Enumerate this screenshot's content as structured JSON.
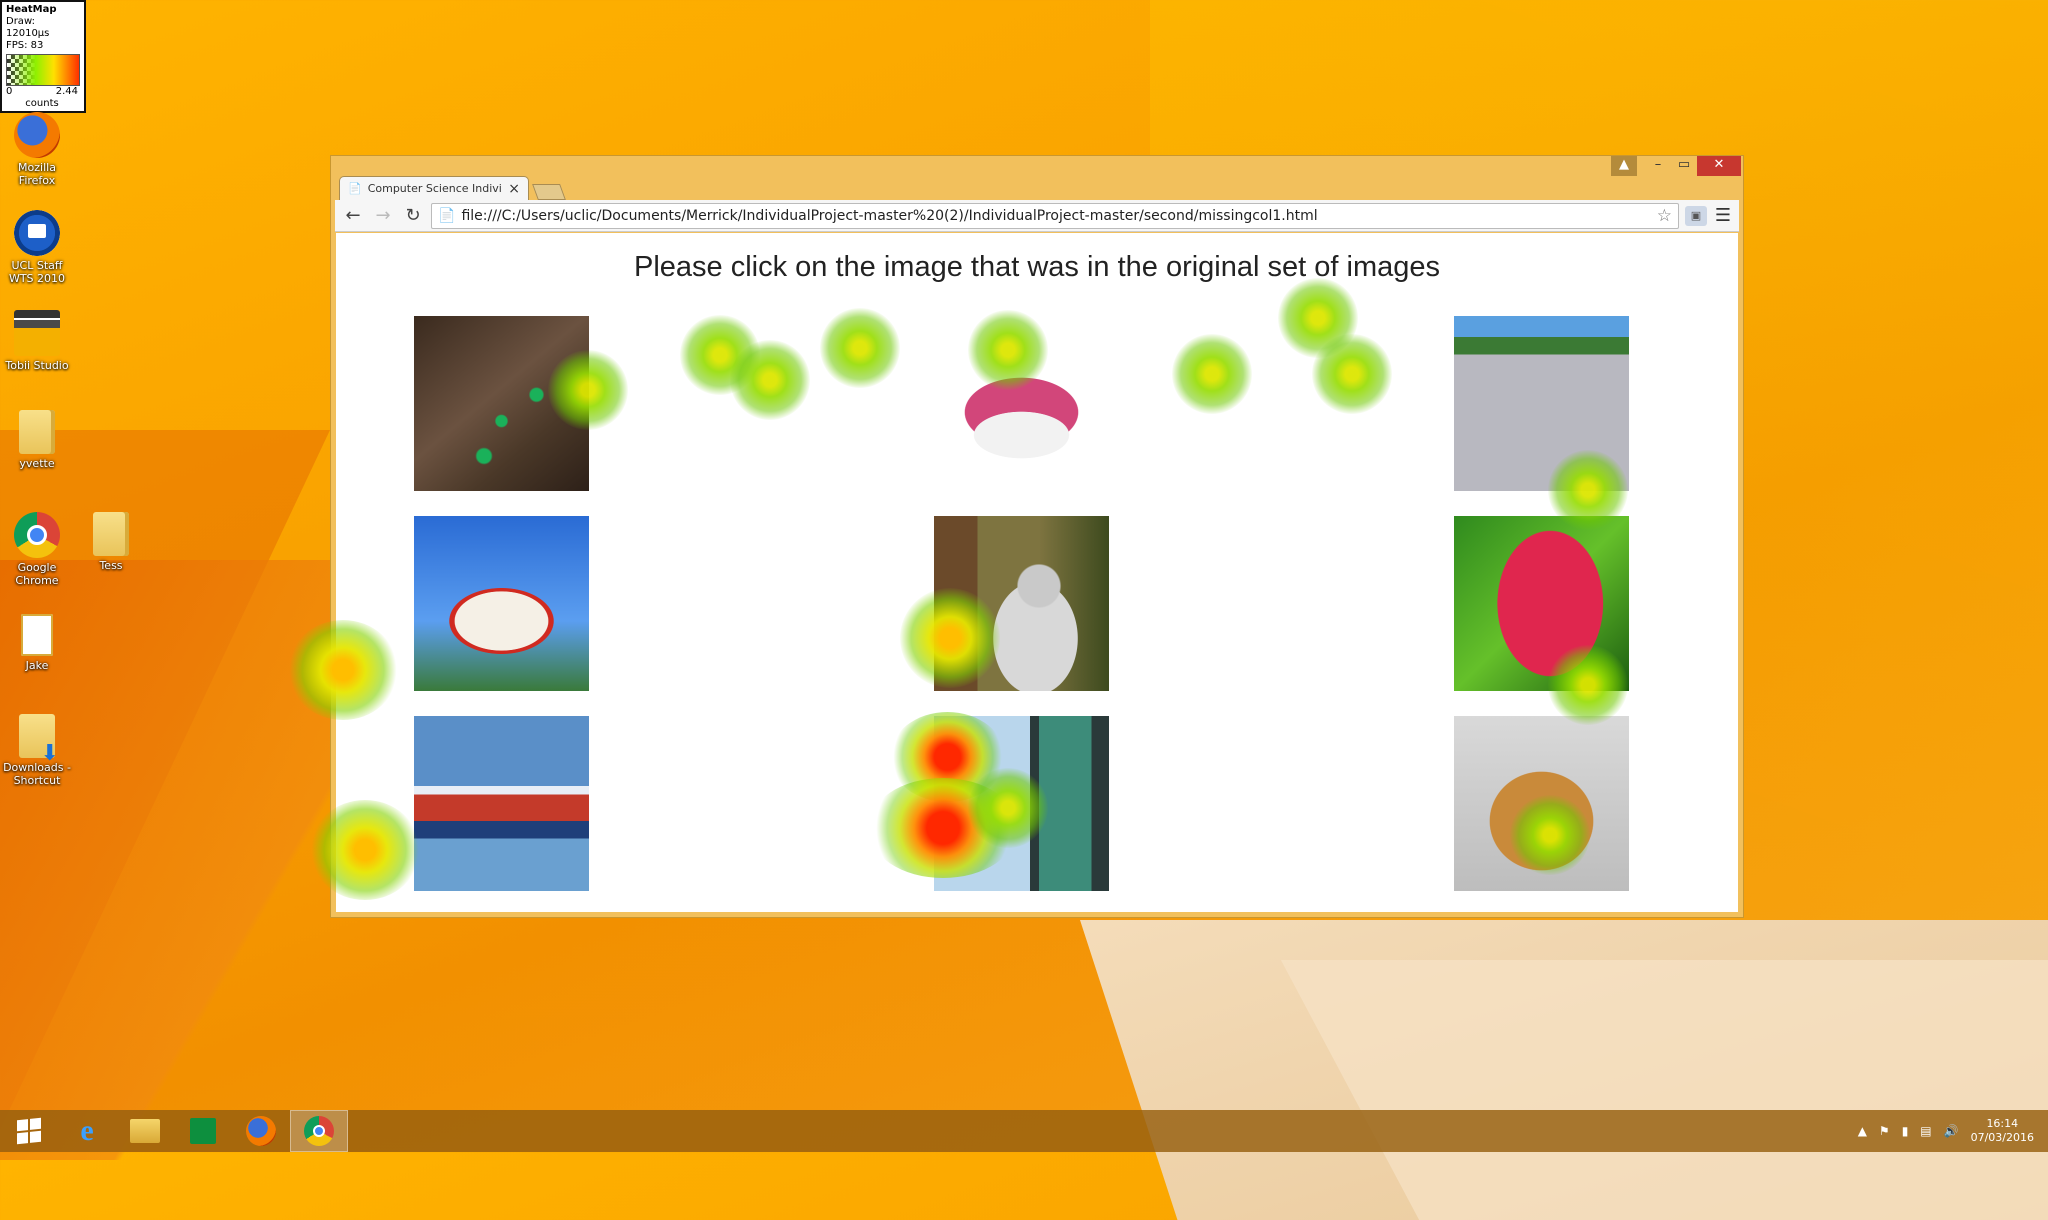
{
  "heatmap": {
    "title": "HeatMap",
    "draw": "Draw: 12010µs",
    "fps": "FPS: 83",
    "scale_min": "0",
    "scale_max": "2.44",
    "unit": "counts"
  },
  "desktop_icons": [
    {
      "label": "Mozilla Firefox",
      "icon": "firefox-icon"
    },
    {
      "label": "UCL Staff WTS 2010",
      "icon": "remote-desktop-icon"
    },
    {
      "label": "Tobii Studio",
      "icon": "tobii-icon"
    },
    {
      "label": "yvette",
      "icon": "folder-icon"
    },
    {
      "label": "Google Chrome",
      "icon": "chrome-icon"
    },
    {
      "label": "Tess",
      "icon": "folder-icon"
    },
    {
      "label": "Jake",
      "icon": "document-icon"
    },
    {
      "label": "Downloads - Shortcut",
      "icon": "downloads-icon"
    }
  ],
  "browser": {
    "tab_title": "Computer Science Individ",
    "url": "file:///C:/Users/uclic/Documents/Merrick/IndividualProject-master%20(2)/IndividualProject-master/second/missingcol1.html",
    "window_controls": {
      "minimize": "–",
      "maximize": "▭",
      "close": "✕"
    }
  },
  "page": {
    "heading": "Please click on the image that was in the original set of images",
    "images": [
      {
        "name": "beetles-image"
      },
      {
        "name": "pink-shoe-image"
      },
      {
        "name": "go-kart-image"
      },
      {
        "name": "las-vegas-sign-image"
      },
      {
        "name": "lemur-image"
      },
      {
        "name": "tulip-image"
      },
      {
        "name": "cargo-ship-image"
      },
      {
        "name": "glass-building-image"
      },
      {
        "name": "gingerbread-house-image"
      }
    ]
  },
  "taskbar": {
    "items": [
      "start",
      "internet-explorer",
      "file-explorer",
      "store",
      "firefox",
      "chrome"
    ],
    "active": "chrome",
    "time": "16:14",
    "date": "07/03/2016"
  }
}
